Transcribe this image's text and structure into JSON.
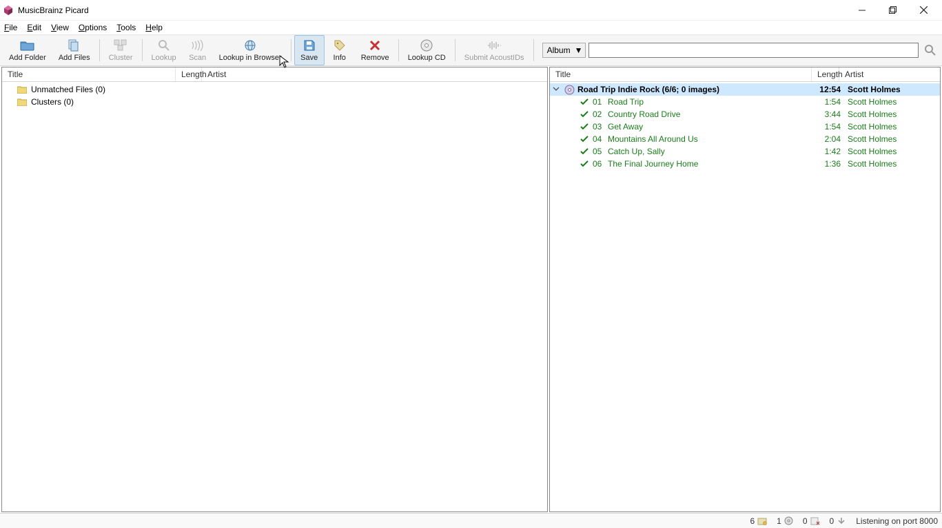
{
  "window": {
    "title": "MusicBrainz Picard"
  },
  "menu": {
    "file": "File",
    "edit": "Edit",
    "view": "View",
    "options": "Options",
    "tools": "Tools",
    "help": "Help"
  },
  "toolbar": {
    "add_folder": "Add Folder",
    "add_files": "Add Files",
    "cluster": "Cluster",
    "lookup": "Lookup",
    "scan": "Scan",
    "lookup_in_browser": "Lookup in Browser",
    "save": "Save",
    "info": "Info",
    "remove": "Remove",
    "lookup_cd": "Lookup CD",
    "submit_acoustids": "Submit AcoustIDs",
    "search_type": "Album"
  },
  "columns": {
    "title": "Title",
    "length": "Length",
    "artist": "Artist"
  },
  "left_tree": {
    "unmatched": "Unmatched Files (0)",
    "clusters": "Clusters (0)"
  },
  "right_tree": {
    "album": {
      "title": "Road Trip Indie Rock (6/6; 0 images)",
      "length": "12:54",
      "artist": "Scott Holmes"
    },
    "tracks": [
      {
        "num": "01",
        "title": "Road Trip",
        "length": "1:54",
        "artist": "Scott Holmes"
      },
      {
        "num": "02",
        "title": "Country Road Drive",
        "length": "3:44",
        "artist": "Scott Holmes"
      },
      {
        "num": "03",
        "title": "Get Away",
        "length": "1:54",
        "artist": "Scott Holmes"
      },
      {
        "num": "04",
        "title": "Mountains All Around Us",
        "length": "2:04",
        "artist": "Scott Holmes"
      },
      {
        "num": "05",
        "title": "Catch Up, Sally",
        "length": "1:42",
        "artist": "Scott Holmes"
      },
      {
        "num": "06",
        "title": "The Final Journey Home",
        "length": "1:36",
        "artist": "Scott Holmes"
      }
    ]
  },
  "status": {
    "c1": "6",
    "c2": "1",
    "c3": "0",
    "c4": "0",
    "listening": "Listening on port 8000"
  }
}
